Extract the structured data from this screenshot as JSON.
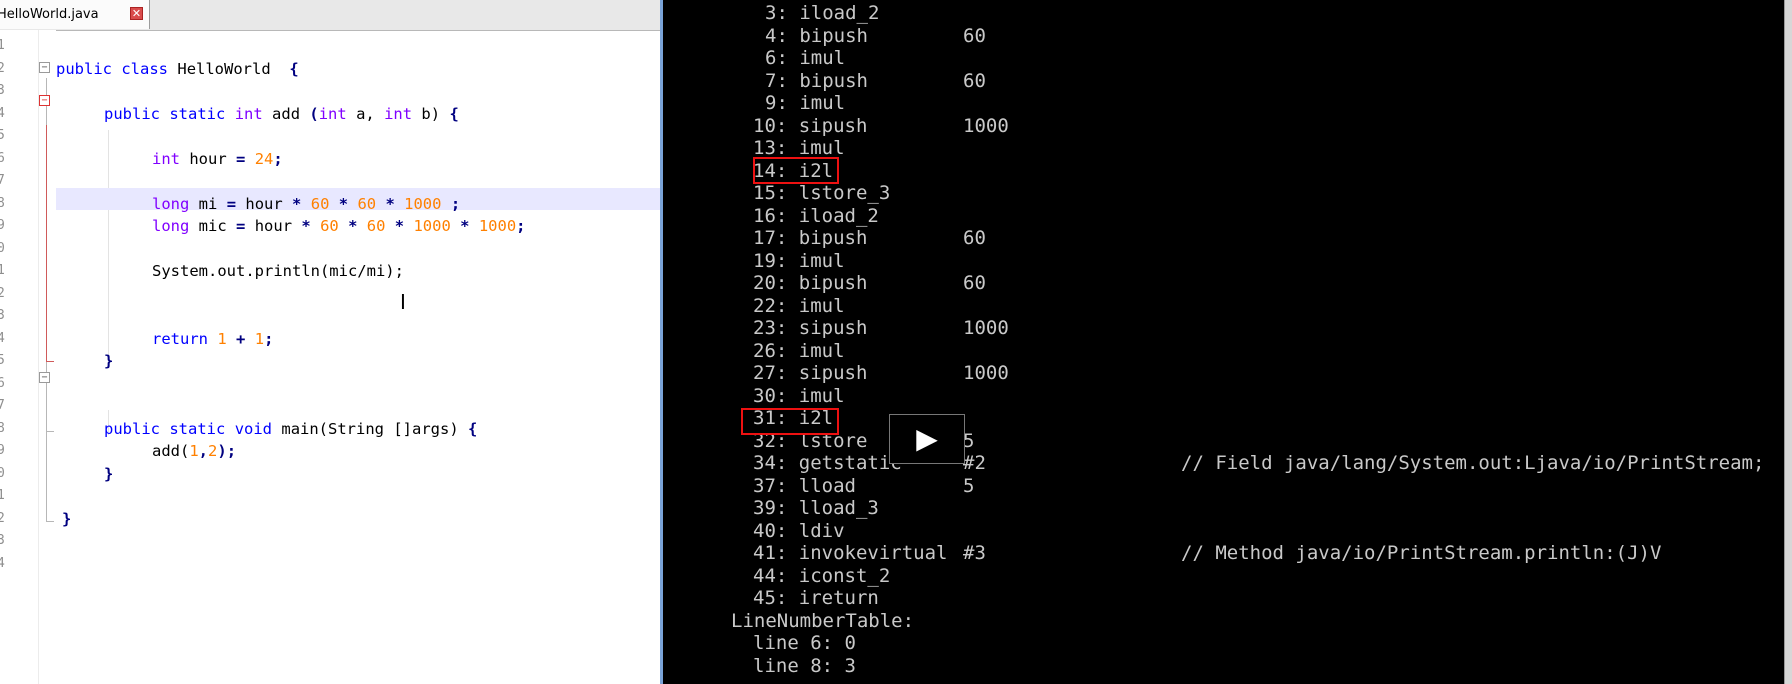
{
  "editor": {
    "tab": {
      "label": "HelloWorld.java",
      "close": "✕"
    },
    "line_numbers": [
      "1",
      "2",
      "3",
      "4",
      "5",
      "6",
      "7",
      "8",
      "9",
      "0",
      "1",
      "2",
      "3",
      "4",
      "5",
      "6",
      "7",
      "8",
      "9",
      "0",
      "1",
      "2",
      "3",
      "4"
    ],
    "code": {
      "l2": {
        "kw1": "public",
        "kw2": "class",
        "name": "HelloWorld",
        "brace": "{"
      },
      "l4": {
        "kw1": "public",
        "kw2": "static",
        "kw3": "int",
        "name": "add",
        "p1": "(",
        "t1": "int",
        "a": "a,",
        "t2": "int",
        "b": "b)",
        "brace": "{"
      },
      "l6": {
        "t": "int",
        "v": "hour",
        "eq": "=",
        "n": "24",
        "end": ";"
      },
      "l8": {
        "t": "long",
        "v": "mi",
        "eq": "=",
        "hour": "hour",
        "m1": "*",
        "n1": "60",
        "m2": "*",
        "n2": "60",
        "m3": "*",
        "n3": "1000",
        "end": ";"
      },
      "l9": {
        "t": "long",
        "v": "mic",
        "eq": "=",
        "hour": "hour",
        "m1": "*",
        "n1": "60",
        "m2": "*",
        "n2": "60",
        "m3": "*",
        "n3": "1000",
        "m4": "*",
        "n4": "1000",
        "end": ";"
      },
      "l11": {
        "text": "System.out.println(mic/mi);"
      },
      "l14": {
        "kw": "return",
        "n1": "1",
        "plus": "+",
        "n2": "1",
        "end": ";"
      },
      "l15": {
        "brace": "}"
      },
      "l18": {
        "kw1": "public",
        "kw2": "static",
        "kw3": "void",
        "rest": "main(String []args)",
        "brace": "{"
      },
      "l19": {
        "call": "add(",
        "n1": "1",
        "comma": ",",
        "n2": "2",
        "end": ");"
      },
      "l20": {
        "brace": "}"
      },
      "l22": {
        "brace": "}"
      }
    },
    "cursor_glyph": "I"
  },
  "console": {
    "lines": [
      {
        "op": "3: iload_2",
        "arg": "",
        "comment": ""
      },
      {
        "op": "4: bipush",
        "arg": "60",
        "comment": ""
      },
      {
        "op": "6: imul",
        "arg": "",
        "comment": ""
      },
      {
        "op": "7: bipush",
        "arg": "60",
        "comment": ""
      },
      {
        "op": "9: imul",
        "arg": "",
        "comment": ""
      },
      {
        "op": "10: sipush",
        "arg": "1000",
        "comment": ""
      },
      {
        "op": "13: imul",
        "arg": "",
        "comment": ""
      },
      {
        "op": "14: i2l",
        "arg": "",
        "comment": ""
      },
      {
        "op": "15: lstore_3",
        "arg": "",
        "comment": ""
      },
      {
        "op": "16: iload_2",
        "arg": "",
        "comment": ""
      },
      {
        "op": "17: bipush",
        "arg": "60",
        "comment": ""
      },
      {
        "op": "19: imul",
        "arg": "",
        "comment": ""
      },
      {
        "op": "20: bipush",
        "arg": "60",
        "comment": ""
      },
      {
        "op": "22: imul",
        "arg": "",
        "comment": ""
      },
      {
        "op": "23: sipush",
        "arg": "1000",
        "comment": ""
      },
      {
        "op": "26: imul",
        "arg": "",
        "comment": ""
      },
      {
        "op": "27: sipush",
        "arg": "1000",
        "comment": ""
      },
      {
        "op": "30: imul",
        "arg": "",
        "comment": ""
      },
      {
        "op": "31: i2l",
        "arg": "",
        "comment": ""
      },
      {
        "op": "32: lstore",
        "arg": "5",
        "comment": ""
      },
      {
        "op": "34: getstatic",
        "arg": "#2",
        "comment": "// Field java/lang/System.out:Ljava/io/PrintStream;"
      },
      {
        "op": "37: lload",
        "arg": "5",
        "comment": ""
      },
      {
        "op": "39: lload_3",
        "arg": "",
        "comment": ""
      },
      {
        "op": "40: ldiv",
        "arg": "",
        "comment": ""
      },
      {
        "op": "41: invokevirtual",
        "arg": "#3",
        "comment": "// Method java/io/PrintStream.println:(J)V"
      },
      {
        "op": "44: iconst_2",
        "arg": "",
        "comment": ""
      },
      {
        "op": "45: ireturn",
        "arg": "",
        "comment": ""
      },
      {
        "op": "LineNumberTable:",
        "arg": "",
        "comment": ""
      },
      {
        "op": "line 6: 0",
        "arg": "",
        "comment": ""
      },
      {
        "op": "line 8: 3",
        "arg": "",
        "comment": ""
      }
    ],
    "play_icon": "▶",
    "colors": {
      "background": "#000000",
      "text": "#c9c9c9",
      "highlight_box": "#ee1111"
    }
  }
}
